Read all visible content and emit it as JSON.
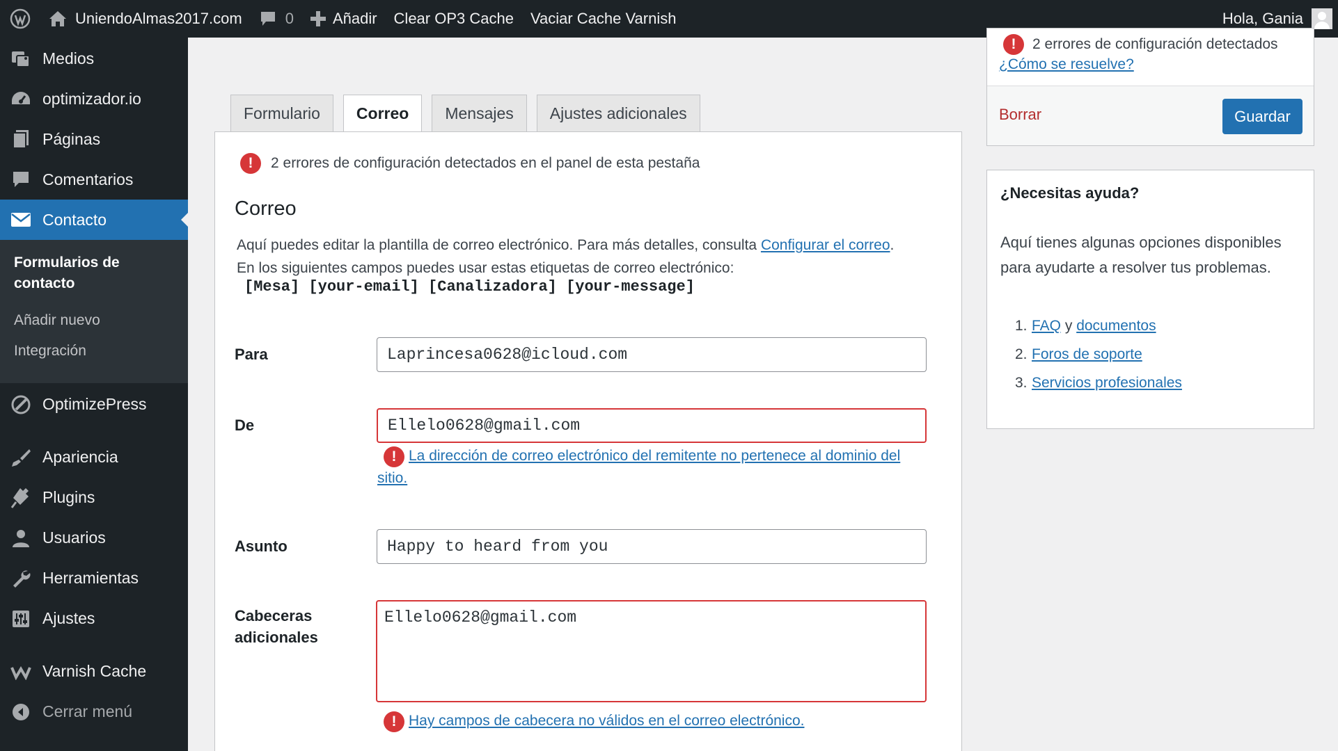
{
  "adminbar": {
    "wp_icon": "wordpress-logo-icon",
    "site_name": "UniendoAlmas2017.com",
    "comments_count": "0",
    "add_new": "Añadir",
    "clear_cache": "Clear OP3 Cache",
    "varnish": "Vaciar Cache Varnish",
    "greeting": "Hola, Gania"
  },
  "sidebar": {
    "items": [
      {
        "label": "Medios",
        "icon": "media-icon"
      },
      {
        "label": "optimizador.io",
        "icon": "dashboard-gauge-icon"
      },
      {
        "label": "Páginas",
        "icon": "pages-icon"
      },
      {
        "label": "Comentarios",
        "icon": "comments-icon"
      },
      {
        "label": "Contacto",
        "icon": "envelope-icon",
        "active": true
      },
      {
        "label": "OptimizePress",
        "icon": "optimizepress-icon"
      },
      {
        "label": "Apariencia",
        "icon": "appearance-brush-icon"
      },
      {
        "label": "Plugins",
        "icon": "plugins-icon"
      },
      {
        "label": "Usuarios",
        "icon": "users-icon"
      },
      {
        "label": "Herramientas",
        "icon": "tools-wrench-icon"
      },
      {
        "label": "Ajustes",
        "icon": "settings-sliders-icon"
      },
      {
        "label": "Varnish Cache",
        "icon": "varnish-icon"
      },
      {
        "label": "Cerrar menú",
        "icon": "collapse-menu-icon"
      }
    ],
    "submenu": {
      "current": "Formularios de contacto",
      "add_new": "Añadir nuevo",
      "integration": "Integración"
    }
  },
  "tabs": [
    "Formulario",
    "Correo",
    "Mensajes",
    "Ajustes adicionales"
  ],
  "active_tab": "Correo",
  "panel": {
    "config_errors": "2 errores de configuración detectados en el panel de esta pestaña",
    "title": "Correo",
    "desc_line1": "Aquí puedes editar la plantilla de correo electrónico. Para más detalles, consulta ",
    "desc_link": "Configurar el correo",
    "desc_line1_end": ".",
    "desc_line2": "En los siguientes campos puedes usar estas etiquetas de correo electrónico:",
    "tags": "[Mesa] [your-email] [Canalizadora] [your-message]",
    "fields": {
      "to": {
        "label": "Para",
        "value": "Laprincesa0628@icloud.com"
      },
      "from": {
        "label": "De",
        "value": "Ellelo0628@gmail.com",
        "error": "La dirección de correo electrónico del remitente no pertenece al dominio del sitio."
      },
      "subject": {
        "label": "Asunto",
        "value": "Happy to heard from you"
      },
      "headers": {
        "label_line1": "Cabeceras",
        "label_line2": "adicionales",
        "value": "Ellelo0628@gmail.com",
        "error": "Hay campos de cabecera no válidos en el correo electrónico."
      }
    }
  },
  "publish": {
    "errors": "2 errores de configuración detectados",
    "how_link": "¿Cómo se resuelve?",
    "delete": "Borrar",
    "save": "Guardar"
  },
  "help": {
    "title": "¿Necesitas ayuda?",
    "text": "Aquí tienes algunas opciones disponibles para ayudarte a resolver tus problemas.",
    "items": [
      {
        "num": "1.",
        "link1": "FAQ",
        "conj": " y ",
        "link2": "documentos"
      },
      {
        "num": "2.",
        "link1": "Foros de soporte"
      },
      {
        "num": "3.",
        "link1": "Servicios profesionales"
      }
    ]
  },
  "colors": {
    "adminbar_bg": "#1d2327",
    "accent": "#2271b1",
    "error": "#d63638",
    "delete": "#b32d2e"
  }
}
